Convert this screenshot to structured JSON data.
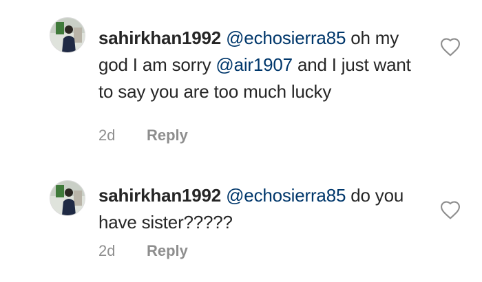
{
  "comments": [
    {
      "username": "sahirkhan1992",
      "segments": [
        {
          "type": "mention",
          "text": "@echosierra85"
        },
        {
          "type": "text",
          "text": " oh my god I am sorry "
        },
        {
          "type": "mention",
          "text": "@air1907"
        },
        {
          "type": "text",
          "text": " and I just want to say you are too much lucky"
        }
      ],
      "time": "2d",
      "reply_label": "Reply"
    },
    {
      "username": "sahirkhan1992",
      "segments": [
        {
          "type": "mention",
          "text": "@echosierra85"
        },
        {
          "type": "text",
          "text": " do you have sister?????"
        }
      ],
      "time": "2d",
      "reply_label": "Reply"
    }
  ],
  "colors": {
    "text": "#262626",
    "mention": "#00376b",
    "meta": "#8e8e8e"
  },
  "icons": {
    "avatar": "profile-photo",
    "like": "heart-outline-icon"
  }
}
